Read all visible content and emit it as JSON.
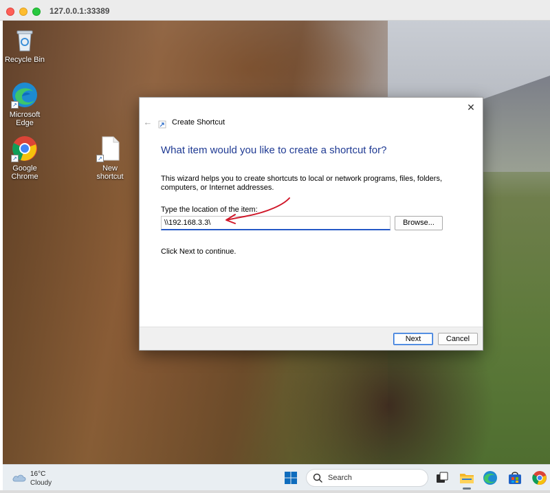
{
  "window": {
    "title": "127.0.0.1:33389"
  },
  "desktop": {
    "icons": [
      {
        "label": "Recycle Bin"
      },
      {
        "label": "Microsoft Edge"
      },
      {
        "label": "Google Chrome"
      },
      {
        "label": "New shortcut"
      }
    ]
  },
  "dialog": {
    "title": "Create Shortcut",
    "close_glyph": "✕",
    "back_glyph": "←",
    "heading": "What item would you like to create a shortcut for?",
    "description": "This wizard helps you to create shortcuts to local or network programs, files, folders, computers, or Internet addresses.",
    "location_label": "Type the location of the item:",
    "location_value": "\\\\192.168.3.3\\",
    "browse_label": "Browse...",
    "continue_text": "Click Next to continue.",
    "next_label": "Next",
    "cancel_label": "Cancel"
  },
  "taskbar": {
    "weather_temp": "16°C",
    "weather_condition": "Cloudy",
    "search_placeholder": "Search",
    "icons": [
      "start-icon",
      "search-icon",
      "task-view-icon",
      "file-explorer-icon",
      "edge-icon",
      "store-icon",
      "chrome-icon"
    ]
  },
  "colors": {
    "heading": "#1f3a93",
    "input_focus": "#2458c6",
    "annotation_arrow": "#d0182a"
  }
}
